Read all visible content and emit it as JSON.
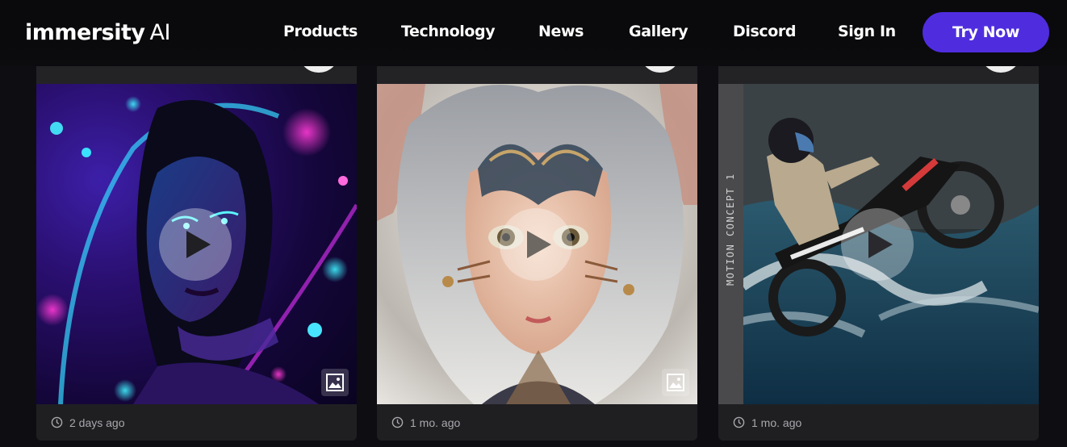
{
  "header": {
    "logo_main": "immersity",
    "logo_suffix": "AI",
    "nav": [
      "Products",
      "Technology",
      "News",
      "Gallery",
      "Discord",
      "Sign In"
    ],
    "cta": "Try Now",
    "cta_color": "#4f2ddf"
  },
  "cards": [
    {
      "time": "2 days ago",
      "media_icon": "image-icon"
    },
    {
      "time": "1 mo. ago",
      "media_icon": "image-icon"
    },
    {
      "time": "1 mo. ago",
      "side_label": "MOTION CONCEPT 1"
    }
  ],
  "icons": [
    "play-icon",
    "clock-icon",
    "image-icon"
  ]
}
